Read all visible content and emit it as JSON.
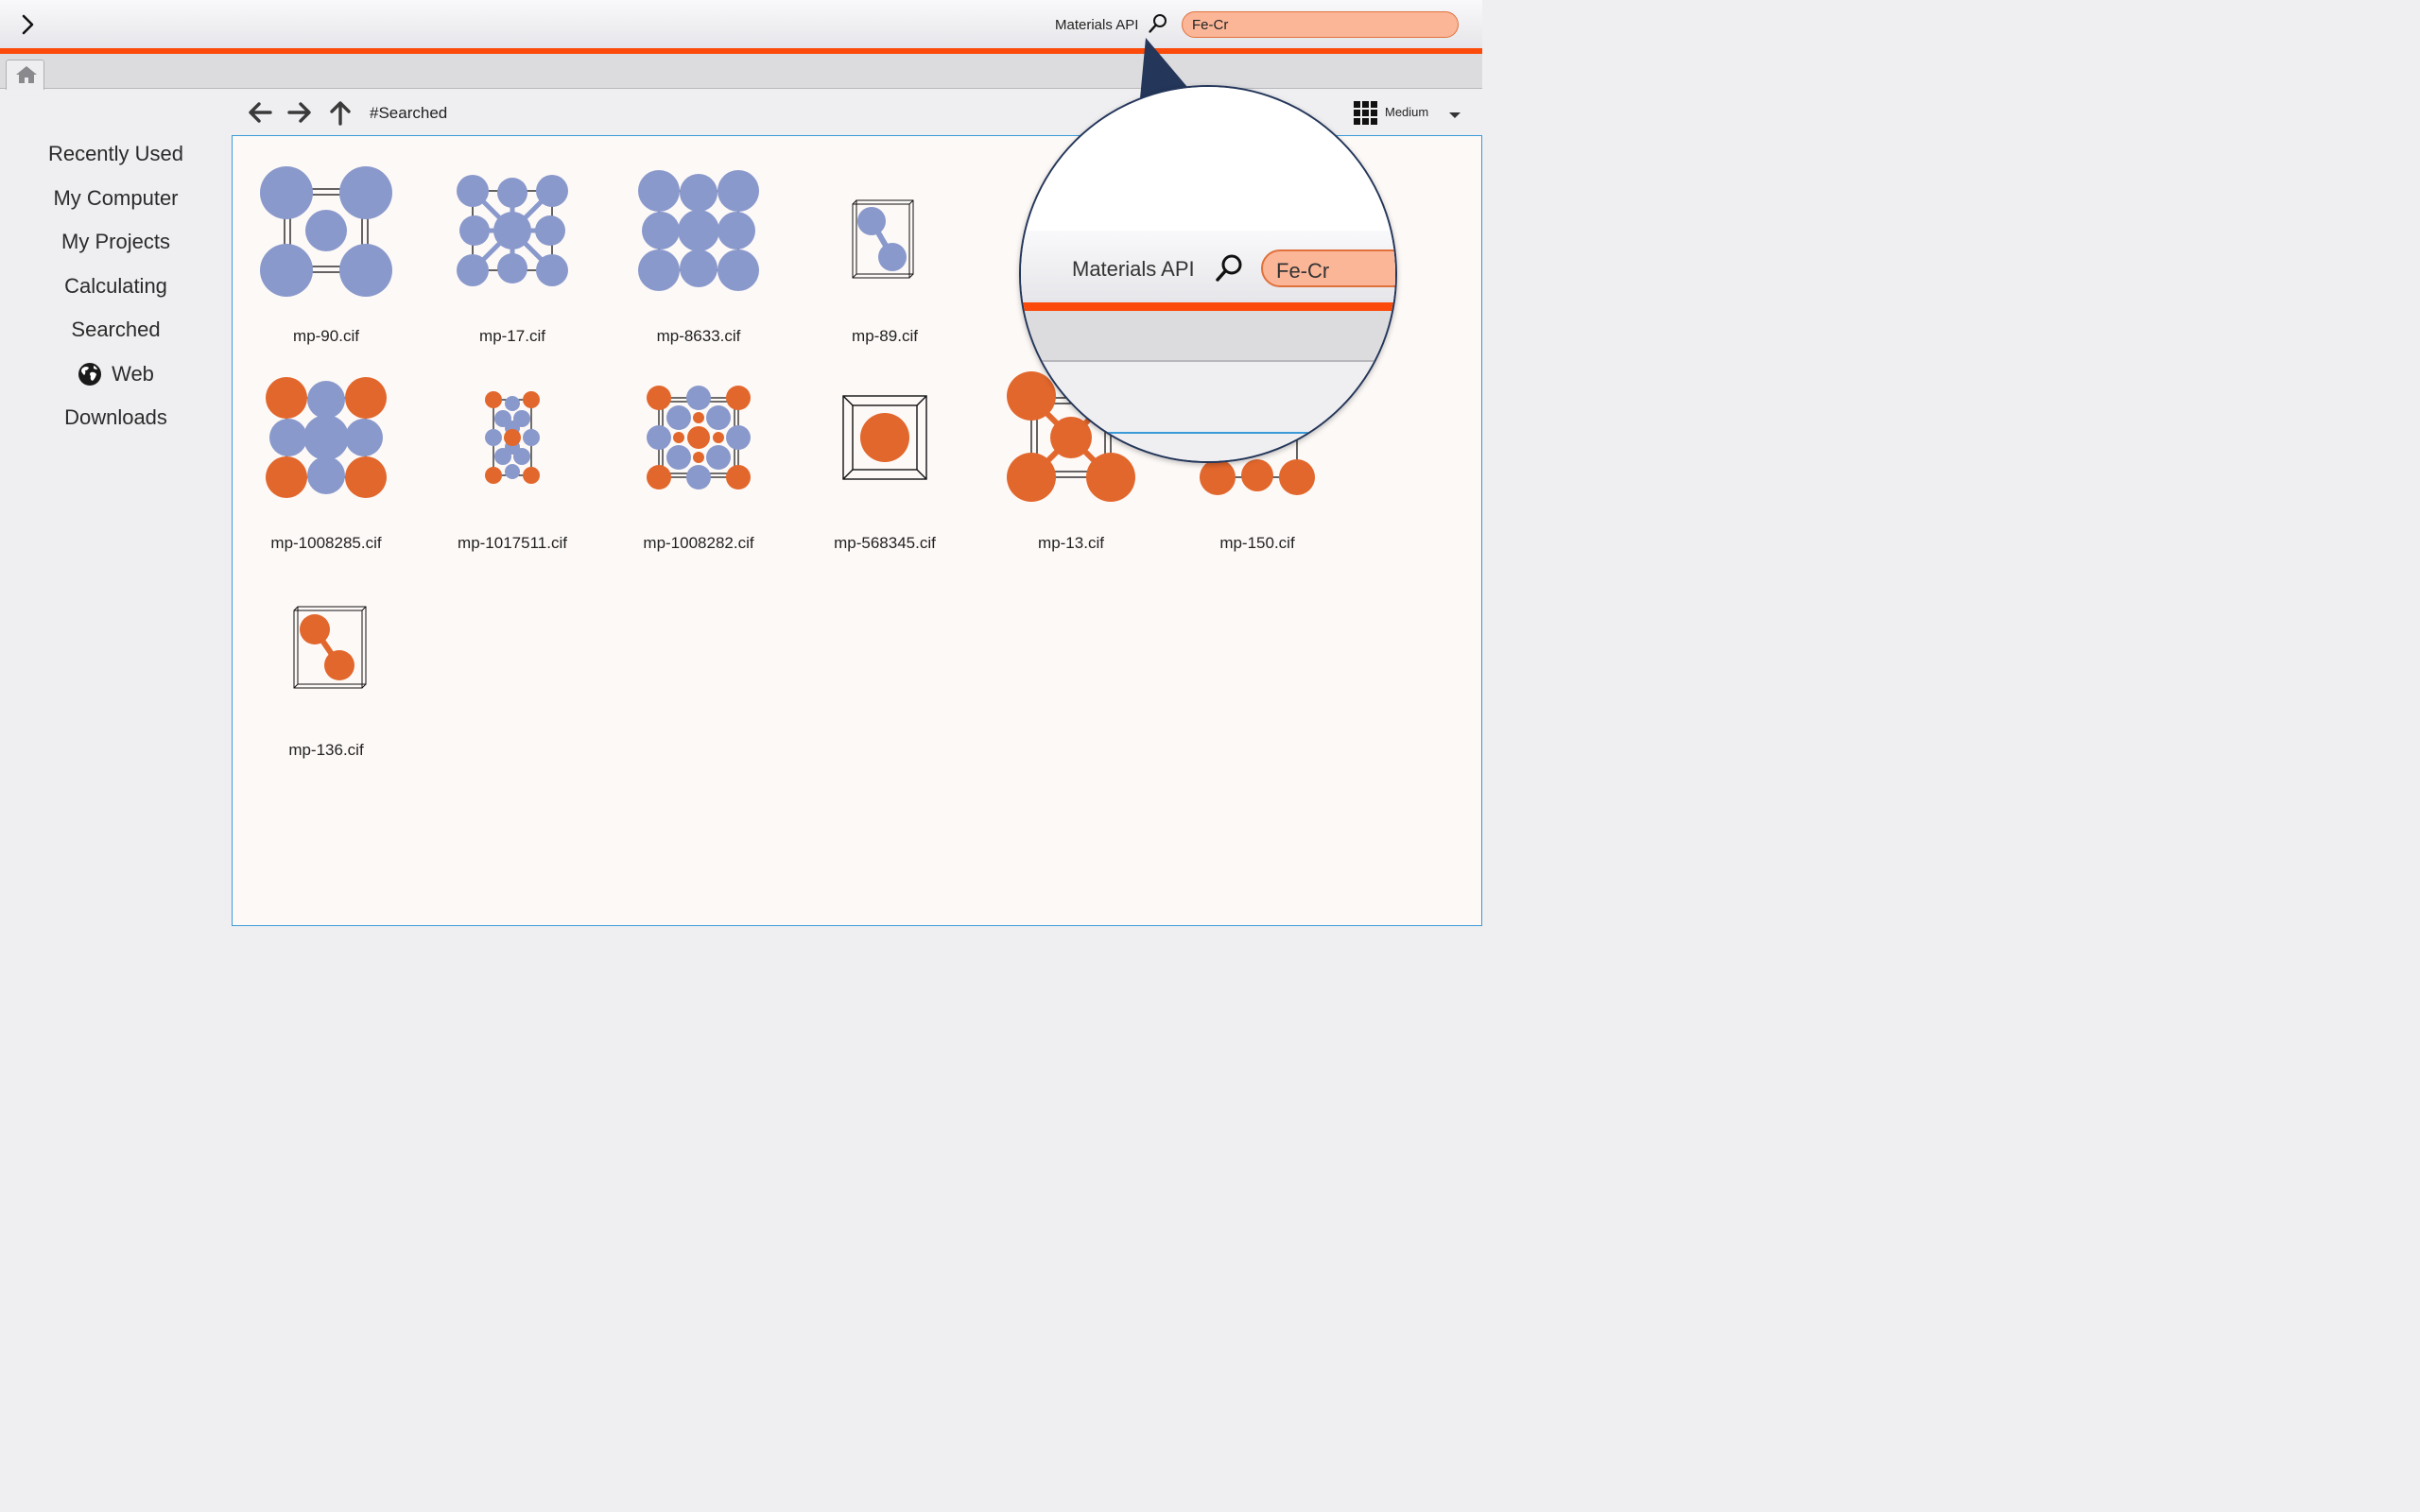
{
  "topbar": {
    "api_label": "Materials API",
    "search_value": "Fe-Cr"
  },
  "sidebar": {
    "items": [
      {
        "label": "Recently Used",
        "icon": ""
      },
      {
        "label": "My Computer",
        "icon": ""
      },
      {
        "label": "My Projects",
        "icon": ""
      },
      {
        "label": "Calculating",
        "icon": ""
      },
      {
        "label": "Searched",
        "icon": ""
      },
      {
        "label": "Web",
        "icon": "globe-icon"
      },
      {
        "label": "Downloads",
        "icon": ""
      }
    ]
  },
  "toolbar": {
    "path": "#Searched",
    "view_size": "Medium"
  },
  "files": [
    {
      "name": "mp-90.cif",
      "element": "Cr",
      "structure": "bcc"
    },
    {
      "name": "mp-17.cif",
      "element": "Cr",
      "structure": "dense"
    },
    {
      "name": "mp-8633.cif",
      "element": "Cr",
      "structure": "dense"
    },
    {
      "name": "mp-89.cif",
      "element": "Cr",
      "structure": "dimer"
    },
    {
      "name": "mp-1008285.cif",
      "element": "Fe-Cr",
      "structure": "mixed"
    },
    {
      "name": "mp-1017511.cif",
      "element": "Fe-Cr",
      "structure": "mixed-small"
    },
    {
      "name": "mp-1008282.cif",
      "element": "Fe-Cr",
      "structure": "mixed-dense"
    },
    {
      "name": "mp-568345.cif",
      "element": "Fe",
      "structure": "single"
    },
    {
      "name": "mp-13.cif",
      "element": "Fe",
      "structure": "bcc"
    },
    {
      "name": "mp-150.cif",
      "element": "Fe",
      "structure": "bcc"
    },
    {
      "name": "mp-136.cif",
      "element": "Fe",
      "structure": "dimer"
    }
  ],
  "magnifier": {
    "api_label": "Materials API",
    "search_value": "Fe-Cr"
  },
  "colors": {
    "accent": "#fb4a0a",
    "chromium_atom": "#8a99cc",
    "iron_atom": "#e2672c",
    "search_fill": "#fbb698",
    "panel_border": "#3b9ad8",
    "callout": "#24365a"
  }
}
